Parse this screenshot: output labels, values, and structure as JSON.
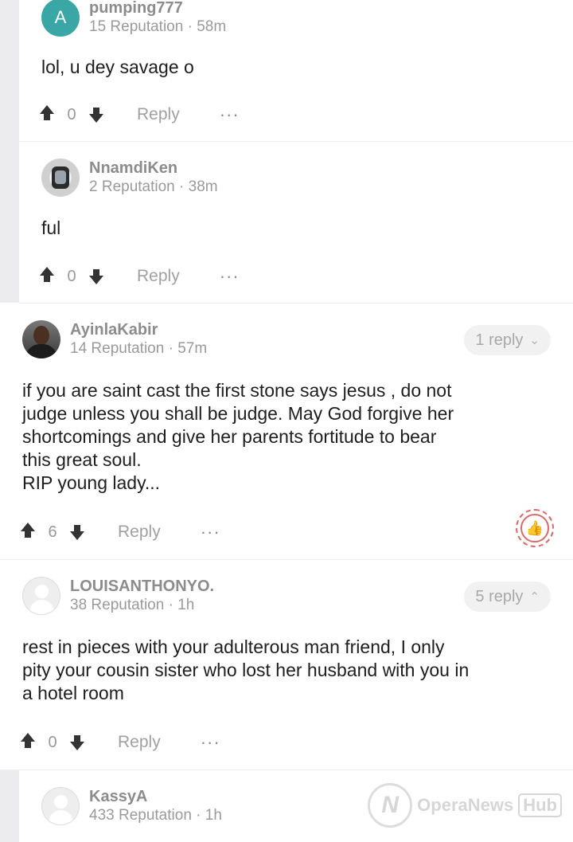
{
  "comments": [
    {
      "avatar_letter": "A",
      "username": "pumping777",
      "reputation": "15 Reputation",
      "time": "58m",
      "text": "lol, u dey savage o",
      "votes": "0",
      "reply_label": "Reply",
      "more": "···"
    },
    {
      "username": "NnamdiKen",
      "reputation": "2 Reputation",
      "time": "38m",
      "text": "ful",
      "votes": "0",
      "reply_label": "Reply",
      "more": "···"
    },
    {
      "username": "AyinlaKabir",
      "reputation": "14 Reputation",
      "time": "57m",
      "replies": "1 reply",
      "text_lines": [
        "if you are saint cast the first stone says jesus , do not",
        "judge unless you shall be judge. May God forgive her",
        "shortcomings and give her parents fortitude to bear",
        "this great soul.",
        "RIP young lady..."
      ],
      "votes": "6",
      "reply_label": "Reply",
      "more": "···"
    },
    {
      "username": "LOUISANTHONYO.",
      "reputation": "38 Reputation",
      "time": "1h",
      "replies": "5 reply",
      "text_lines": [
        "rest in  pieces with your adulterous man friend, I only",
        "pity your cousin sister who lost her husband with you in",
        "a hotel room"
      ],
      "votes": "0",
      "reply_label": "Reply",
      "more": "···"
    },
    {
      "username": "KassyA",
      "reputation": "433 Reputation",
      "time": "1h"
    }
  ],
  "watermark": {
    "logo": "N",
    "brand": "OperaNews",
    "hub": "Hub"
  }
}
